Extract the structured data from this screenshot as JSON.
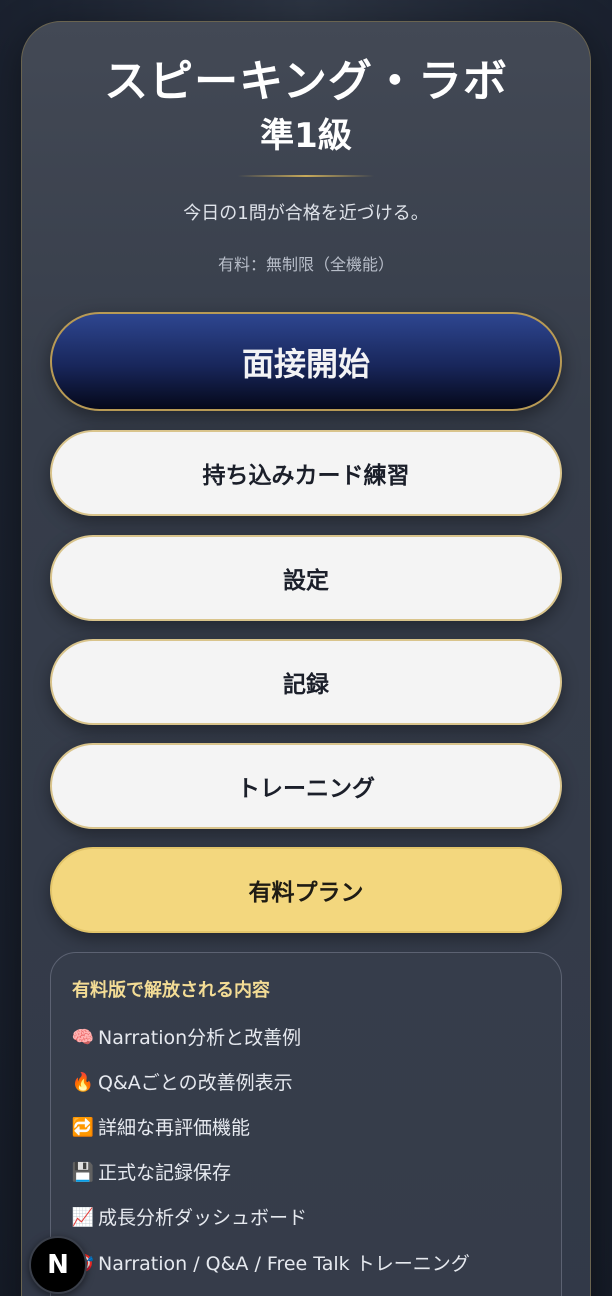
{
  "header": {
    "title": "スピーキング・ラボ",
    "level": "準1級",
    "tagline": "今日の1問が合格を近づける。",
    "plan_status": "有料：無制限（全機能）"
  },
  "buttons": {
    "interview_start": "面接開始",
    "card_practice": "持ち込みカード練習",
    "settings": "設定",
    "records": "記録",
    "training": "トレーニング",
    "paid_plan": "有料プラン"
  },
  "features": {
    "title": "有料版で解放される内容",
    "items": [
      {
        "icon": "brain-icon",
        "emoji": "🧠",
        "label": "Narration分析と改善例"
      },
      {
        "icon": "fire-icon",
        "emoji": "🔥",
        "label": "Q&Aごとの改善例表示"
      },
      {
        "icon": "repeat-icon",
        "emoji": "🔁",
        "label": "詳細な再評価機能"
      },
      {
        "icon": "floppy-disk-icon",
        "emoji": "💾",
        "label": "正式な記録保存"
      },
      {
        "icon": "chart-up-icon",
        "emoji": "📈",
        "label": "成長分析ダッシュボード"
      },
      {
        "icon": "target-icon",
        "emoji": "🎯",
        "label": "Narration / Q&A / Free Talk トレーニング"
      }
    ]
  },
  "badge": {
    "letter": "N"
  },
  "colors": {
    "primary_button": "#1c2b66",
    "gold_button": "#f3d77e",
    "accent_gold": "#c8aa5a",
    "features_title": "#f3dc95"
  }
}
